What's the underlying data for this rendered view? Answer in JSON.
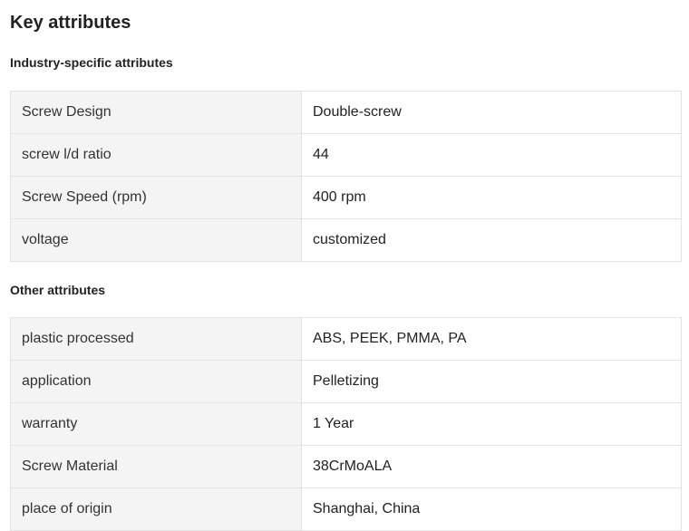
{
  "page": {
    "title": "Key attributes"
  },
  "sections": [
    {
      "title": "Industry-specific attributes",
      "rows": [
        {
          "name": "Screw Design",
          "value": "Double-screw"
        },
        {
          "name": "screw l/d ratio",
          "value": "44"
        },
        {
          "name": "Screw Speed (rpm)",
          "value": "400 rpm"
        },
        {
          "name": "voltage",
          "value": "customized"
        }
      ]
    },
    {
      "title": "Other attributes",
      "rows": [
        {
          "name": "plastic processed",
          "value": "ABS, PEEK, PMMA, PA"
        },
        {
          "name": "application",
          "value": "Pelletizing"
        },
        {
          "name": "warranty",
          "value": "1 Year"
        },
        {
          "name": "Screw Material",
          "value": "38CrMoALA"
        },
        {
          "name": "place of origin",
          "value": "Shanghai, China"
        }
      ]
    }
  ],
  "colors": {
    "label_cell_bg": "#f4f4f4",
    "value_cell_bg": "#ffffff",
    "border": "#e3e3e3",
    "text": "#222222"
  }
}
